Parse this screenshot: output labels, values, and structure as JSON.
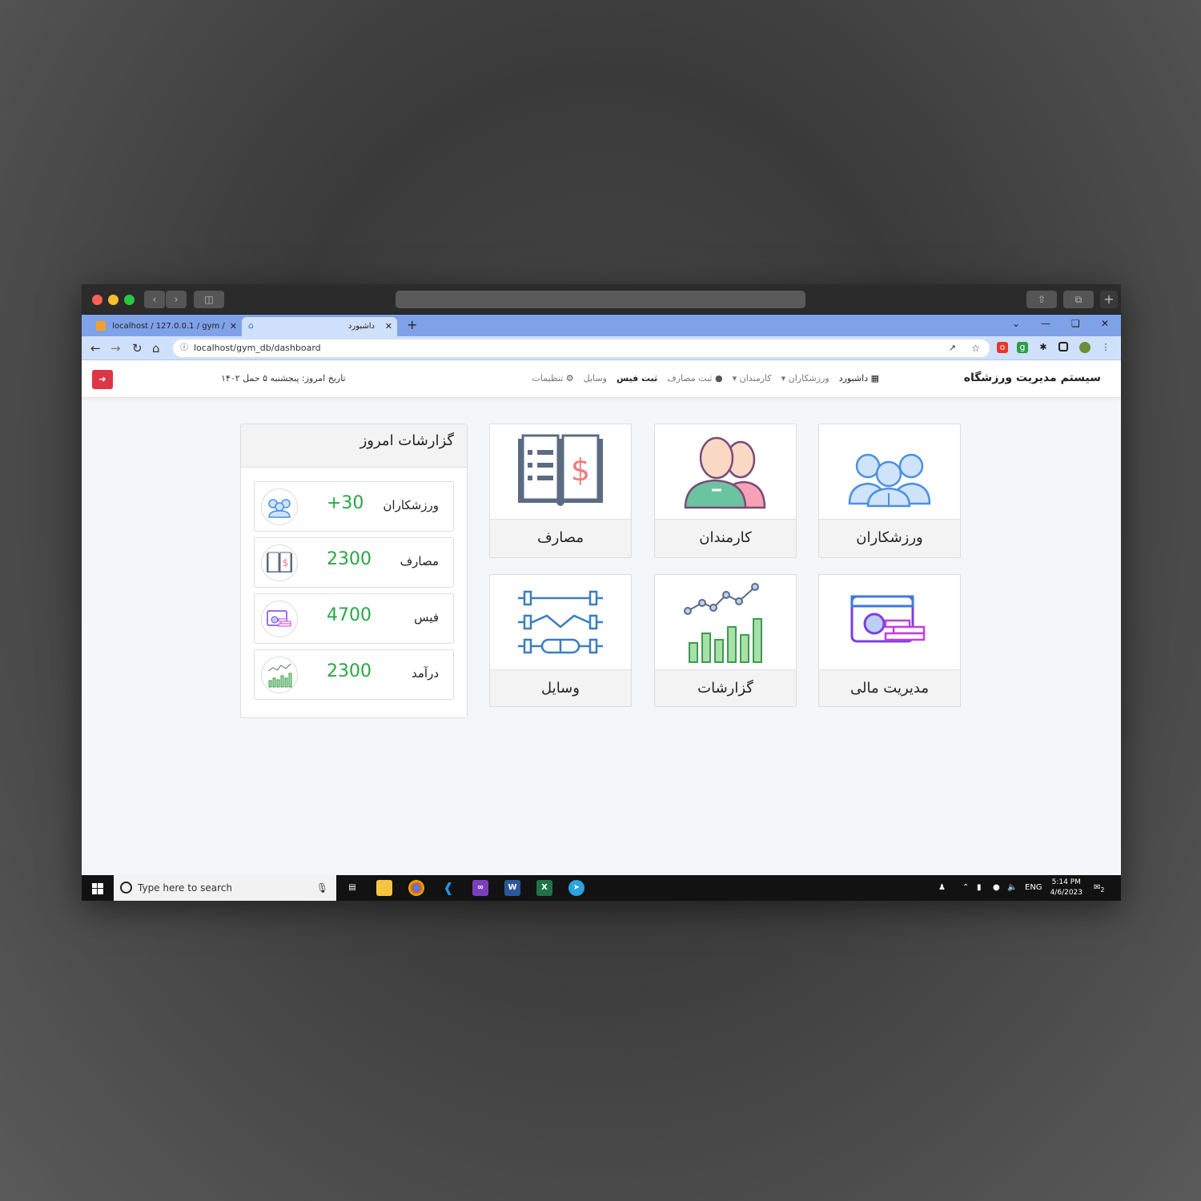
{
  "browser": {
    "tabs": [
      {
        "label": "localhost / 127.0.0.1 / gym / use:"
      },
      {
        "label": "داشبورد"
      }
    ],
    "url": "localhost/gym_db/dashboard"
  },
  "navbar": {
    "brand": "سیستم مدیریت ورزشگاه",
    "links": {
      "dashboard": "داشبورد",
      "athletes": "ورزشکاران",
      "employees": "کارمندان",
      "expenses": "ثبت مصارف",
      "fees": "ثبت فیس",
      "equipment": "وسایل",
      "settings": "تنظیمات"
    },
    "date": "تاریخ امروز: پنجشنبه ۵ حمل ۱۴۰۲"
  },
  "cards": {
    "athletes": "ورزشکاران",
    "employees": "کارمندان",
    "expenses": "مصارف",
    "finance": "مدیریت مالی",
    "reports": "گزارشات",
    "equipment": "وسایل"
  },
  "report": {
    "title": "گزارشات امروز",
    "rows": [
      {
        "label": "ورزشکاران",
        "value": "+30"
      },
      {
        "label": "مصارف",
        "value": "2300"
      },
      {
        "label": "فیس",
        "value": "4700"
      },
      {
        "label": "درآمد",
        "value": "2300"
      }
    ]
  },
  "taskbar": {
    "search_placeholder": "Type here to search",
    "lang": "ENG",
    "time": "5:14 PM",
    "date": "4/6/2023",
    "notif_count": "2"
  },
  "colors": {
    "accent_green": "#28a745",
    "logout_red": "#dc3545",
    "tab_blue": "#7fa1e8"
  }
}
